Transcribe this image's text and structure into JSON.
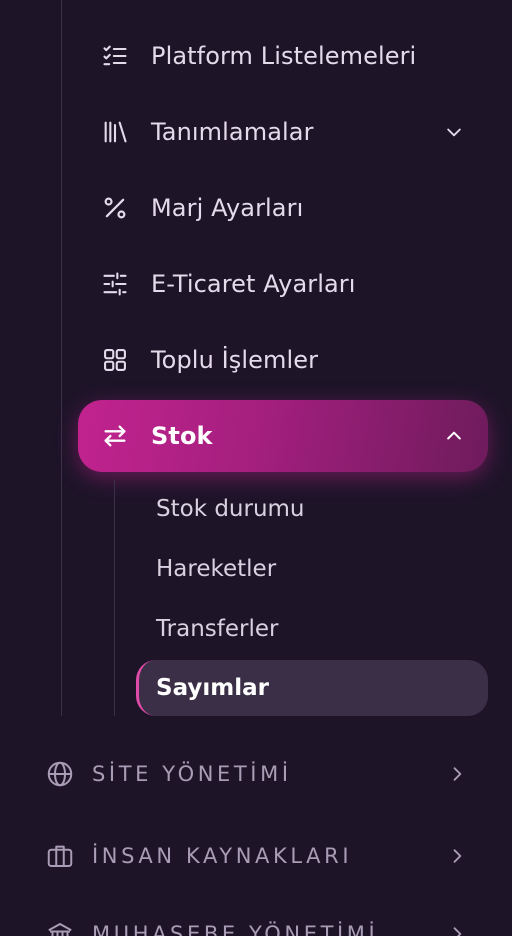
{
  "menu": {
    "items": [
      {
        "label": "Platform Listelemeleri",
        "icon": "list-check-icon"
      },
      {
        "label": "Tanımlamalar",
        "icon": "library-icon",
        "has_chevron": true
      },
      {
        "label": "Marj Ayarları",
        "icon": "percent-icon"
      },
      {
        "label": "E-Ticaret Ayarları",
        "icon": "sliders-icon"
      },
      {
        "label": "Toplu İşlemler",
        "icon": "grid-icon"
      },
      {
        "label": "Stok",
        "icon": "arrows-swap-icon",
        "expanded": true,
        "active": true
      }
    ],
    "stok_submenu": [
      {
        "label": "Stok durumu"
      },
      {
        "label": "Hareketler"
      },
      {
        "label": "Transferler"
      },
      {
        "label": "Sayımlar",
        "active": true
      }
    ]
  },
  "sections": [
    {
      "label": "SİTE YÖNETİMİ",
      "icon": "globe-icon"
    },
    {
      "label": "İNSAN KAYNAKLARI",
      "icon": "briefcase-icon"
    },
    {
      "label": "MUHASEBE YÖNETİMİ",
      "icon": "bank-icon"
    }
  ],
  "colors": {
    "background": "#1d1428",
    "active_gradient_start": "#c2238f",
    "active_gradient_end": "#6e1b5c",
    "active_sub_bg": "#3a2f47",
    "accent": "#e04aa8",
    "text": "#e3dbea",
    "section_text": "#a89db4"
  }
}
